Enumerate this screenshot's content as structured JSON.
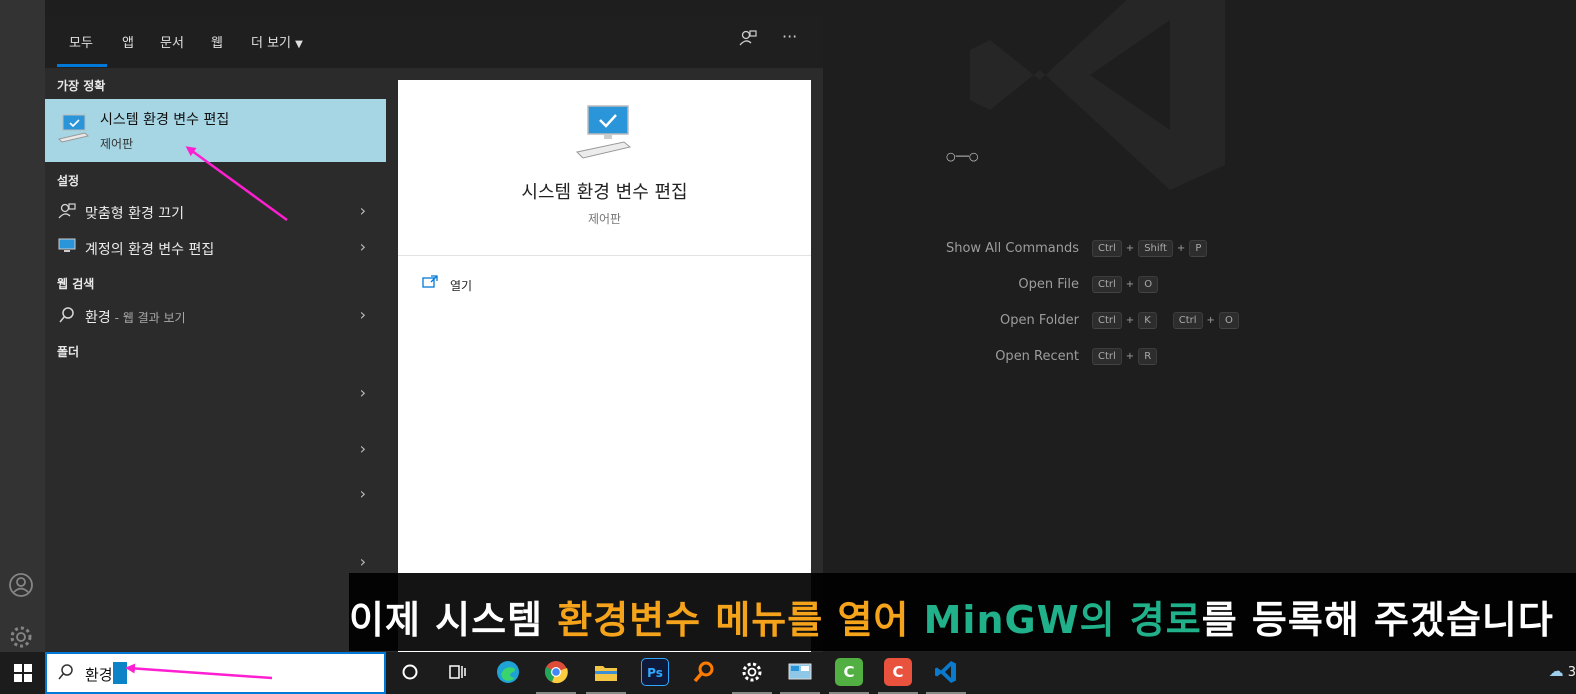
{
  "search_panel": {
    "tabs": {
      "all": "모두",
      "apps": "앱",
      "documents": "문서",
      "web": "웹",
      "more": "더 보기"
    },
    "best_match": {
      "section": "가장 정확",
      "title": "시스템 환경 변수 편집",
      "subtitle": "제어판"
    },
    "settings": {
      "section": "설정",
      "items": [
        {
          "label": "맞춤형 환경 끄기"
        },
        {
          "label": "계정의 환경 변수 편집"
        }
      ]
    },
    "web_search": {
      "section": "웹 검색",
      "query": "환경",
      "hint": " - 웹 결과 보기"
    },
    "folders": {
      "section": "폴더"
    },
    "preview": {
      "title": "시스템 환경 변수 편집",
      "subtitle": "제어판",
      "open_label": "열기"
    }
  },
  "vscode": {
    "shortcuts": [
      {
        "label": "Show All Commands",
        "keys": [
          [
            "Ctrl",
            "Shift",
            "P"
          ]
        ]
      },
      {
        "label": "Open File",
        "keys": [
          [
            "Ctrl",
            "O"
          ]
        ]
      },
      {
        "label": "Open Folder",
        "keys": [
          [
            "Ctrl",
            "K"
          ],
          [
            "Ctrl",
            "O"
          ]
        ]
      },
      {
        "label": "Open Recent",
        "keys": [
          [
            "Ctrl",
            "R"
          ]
        ]
      }
    ]
  },
  "caption": {
    "part1": "이제 시스템 ",
    "part2": "환경변수 메뉴를 열어",
    "part3": " MinGW의 경로",
    "part4": "를 등록해 주겠습니다"
  },
  "taskbar": {
    "search_text": "환경",
    "tray_text": "3"
  },
  "colors": {
    "accent": "#0078d7",
    "best_match_bg": "#a6d5e3",
    "caption_orange": "#f5a31a",
    "caption_teal": "#20b08a",
    "arrow": "#ff1fd2"
  }
}
